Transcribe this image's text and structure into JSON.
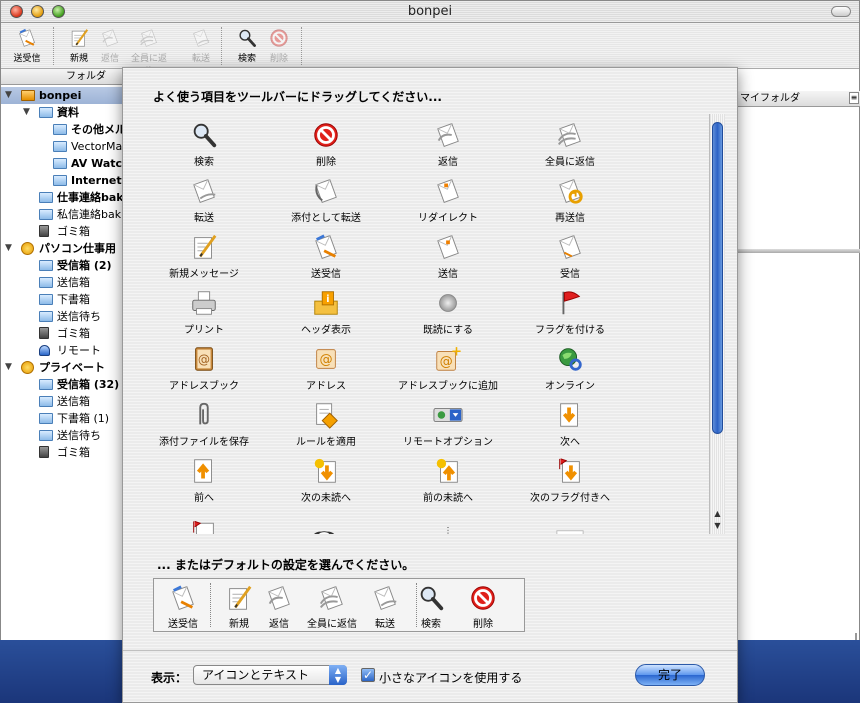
{
  "window": {
    "title": "bonpei"
  },
  "main_toolbar": [
    {
      "label": "送受信",
      "enabled": true,
      "icon": "send-receive-icon"
    },
    {
      "label": "新規",
      "enabled": true,
      "icon": "new-message-icon"
    },
    {
      "label": "返信",
      "enabled": false,
      "icon": "reply-icon"
    },
    {
      "label": "全員に返信",
      "enabled": false,
      "icon": "reply-all-icon"
    },
    {
      "label": "転送",
      "enabled": false,
      "icon": "forward-icon"
    },
    {
      "label": "検索",
      "enabled": true,
      "icon": "search-icon"
    },
    {
      "label": "削除",
      "enabled": false,
      "icon": "delete-icon"
    }
  ],
  "folder_header": "フォルダ",
  "folder_tree": [
    {
      "label": "bonpei",
      "level": 0,
      "bold": true,
      "type": "bonpei",
      "expanded": true,
      "selected": true
    },
    {
      "label": "資料",
      "level": 1,
      "bold": true,
      "type": "folder",
      "expanded": true
    },
    {
      "label": "その他メルマガ",
      "level": 2,
      "bold": true,
      "type": "folder"
    },
    {
      "label": "VectorMa",
      "level": 2,
      "bold": false,
      "type": "folder"
    },
    {
      "label": "AV Watch",
      "level": 2,
      "bold": true,
      "type": "folder"
    },
    {
      "label": "InternetW",
      "level": 2,
      "bold": true,
      "type": "folder"
    },
    {
      "label": "仕事連絡bak",
      "level": 1,
      "bold": true,
      "type": "folder"
    },
    {
      "label": "私信連絡bak",
      "level": 1,
      "bold": false,
      "type": "folder"
    },
    {
      "label": "ゴミ箱",
      "level": 1,
      "bold": false,
      "type": "trash"
    },
    {
      "label": "パソコン仕事用",
      "level": 0,
      "bold": true,
      "type": "account",
      "expanded": true
    },
    {
      "label": "受信箱 (2)",
      "level": 1,
      "bold": true,
      "type": "folder"
    },
    {
      "label": "送信箱",
      "level": 1,
      "bold": false,
      "type": "folder"
    },
    {
      "label": "下書箱",
      "level": 1,
      "bold": false,
      "type": "folder"
    },
    {
      "label": "送信待ち",
      "level": 1,
      "bold": false,
      "type": "folder"
    },
    {
      "label": "ゴミ箱",
      "level": 1,
      "bold": false,
      "type": "trash"
    },
    {
      "label": "リモート",
      "level": 1,
      "bold": false,
      "type": "remote"
    },
    {
      "label": "プライベート",
      "level": 0,
      "bold": true,
      "type": "account",
      "expanded": true
    },
    {
      "label": "受信箱 (32)",
      "level": 1,
      "bold": true,
      "type": "folder"
    },
    {
      "label": "送信箱",
      "level": 1,
      "bold": false,
      "type": "folder"
    },
    {
      "label": "下書箱 (1)",
      "level": 1,
      "bold": false,
      "type": "folder"
    },
    {
      "label": "送信待ち",
      "level": 1,
      "bold": false,
      "type": "folder"
    },
    {
      "label": "ゴミ箱",
      "level": 1,
      "bold": false,
      "type": "trash"
    }
  ],
  "right_header": "マイフォルダ",
  "sheet": {
    "header": "よく使う項目をツールバーにドラッグしてください...",
    "palette": [
      {
        "label": "検索",
        "icon": "search-icon"
      },
      {
        "label": "削除",
        "icon": "delete-icon"
      },
      {
        "label": "返信",
        "icon": "reply-icon"
      },
      {
        "label": "全員に返信",
        "icon": "reply-all-icon"
      },
      {
        "label": "転送",
        "icon": "forward-icon"
      },
      {
        "label": "添付として転送",
        "icon": "forward-attachment-icon"
      },
      {
        "label": "リダイレクト",
        "icon": "redirect-icon"
      },
      {
        "label": "再送信",
        "icon": "resend-icon"
      },
      {
        "label": "新規メッセージ",
        "icon": "new-message-icon"
      },
      {
        "label": "送受信",
        "icon": "send-receive-icon"
      },
      {
        "label": "送信",
        "icon": "send-icon"
      },
      {
        "label": "受信",
        "icon": "receive-icon"
      },
      {
        "label": "プリント",
        "icon": "printer-icon"
      },
      {
        "label": "ヘッダ表示",
        "icon": "header-info-icon"
      },
      {
        "label": "既読にする",
        "icon": "mark-read-icon"
      },
      {
        "label": "フラグを付ける",
        "icon": "flag-icon"
      },
      {
        "label": "アドレスブック",
        "icon": "address-book-icon"
      },
      {
        "label": "アドレス",
        "icon": "address-icon"
      },
      {
        "label": "アドレスブックに追加",
        "icon": "add-address-icon"
      },
      {
        "label": "オンライン",
        "icon": "online-icon"
      },
      {
        "label": "添付ファイルを保存",
        "icon": "paperclip-icon"
      },
      {
        "label": "ルールを適用",
        "icon": "apply-rule-icon"
      },
      {
        "label": "リモートオプション",
        "icon": "remote-option-icon"
      },
      {
        "label": "次へ",
        "icon": "next-icon"
      },
      {
        "label": "前へ",
        "icon": "previous-icon"
      },
      {
        "label": "次の未読へ",
        "icon": "next-unread-icon"
      },
      {
        "label": "前の未読へ",
        "icon": "previous-unread-icon"
      },
      {
        "label": "次のフラグ付きへ",
        "icon": "next-flagged-icon"
      },
      {
        "label": "",
        "icon": "previous-flagged-icon"
      },
      {
        "label": "",
        "icon": "separator-item-icon"
      },
      {
        "label": "",
        "icon": "space-item-icon"
      },
      {
        "label": "",
        "icon": "flexible-space-icon"
      }
    ],
    "default_label": "... またはデフォルトの設定を選んでください。",
    "default_set": [
      {
        "label": "送受信",
        "icon": "send-receive-icon"
      },
      {
        "label": "新規",
        "icon": "new-message-icon"
      },
      {
        "label": "返信",
        "icon": "reply-icon"
      },
      {
        "label": "全員に返信",
        "icon": "reply-all-icon"
      },
      {
        "label": "転送",
        "icon": "forward-icon"
      },
      {
        "label": "検索",
        "icon": "search-icon"
      },
      {
        "label": "削除",
        "icon": "delete-icon"
      }
    ],
    "show_label": "表示：",
    "show_value": "アイコンとテキスト",
    "small_icons_label": "小さなアイコンを使用する",
    "small_icons_checked": true,
    "done_label": "完了"
  },
  "colors": {
    "accent": "#2a63c8",
    "sheet_bg": "#f0f0f0",
    "dock": "#1b367a"
  }
}
